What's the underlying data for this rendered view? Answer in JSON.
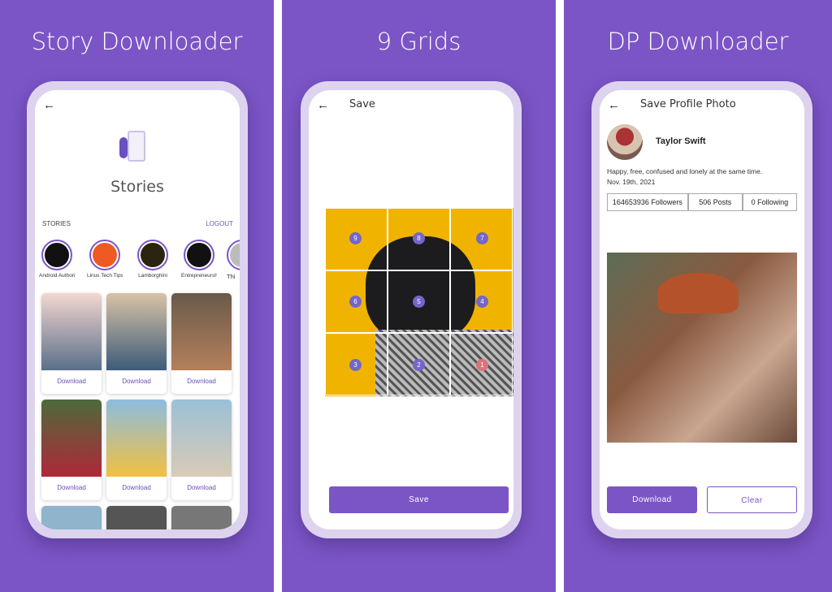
{
  "panels": [
    {
      "title": "Story Downloader",
      "screen": {
        "heading": "Stories",
        "section_label": "STORIES",
        "logout": "LOGOUT",
        "stories": [
          {
            "name": "Android Authori...",
            "color": "#111"
          },
          {
            "name": "Linus Tech Tips",
            "color": "#ef5a24"
          },
          {
            "name": "Lamborghini",
            "color": "#2b2410"
          },
          {
            "name": "Entrepreneurshi...",
            "color": "#111"
          },
          {
            "name": "Thi",
            "color": "#bbb"
          }
        ],
        "download_label": "Download"
      }
    },
    {
      "title": "9 Grids",
      "screen": {
        "header": "Save",
        "grid_numbers": [
          "9",
          "8",
          "7",
          "6",
          "5",
          "4",
          "3",
          "2",
          "1"
        ],
        "save_label": "Save",
        "grid_color": "#f0b400"
      }
    },
    {
      "title": "DP Downloader",
      "screen": {
        "header": "Save Profile Photo",
        "name": "Taylor Swift",
        "bio": "Happy, free, confused and lonely at the same time.",
        "date": "Nov. 19th, 2021",
        "followers": "164653936 Followers",
        "posts": "506 Posts",
        "following": "0 Following",
        "download_label": "Download",
        "clear_label": "Clear"
      }
    }
  ],
  "colors": {
    "accent": "#7b55c6"
  }
}
